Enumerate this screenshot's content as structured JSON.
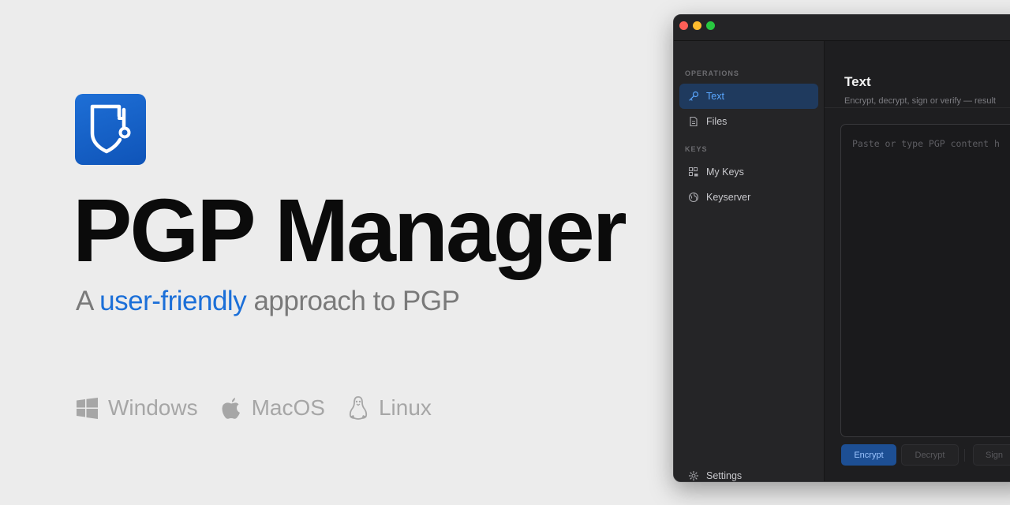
{
  "hero": {
    "title": "PGP Manager",
    "subtitle_prefix": "A ",
    "subtitle_accent": "user-friendly",
    "subtitle_suffix": " approach to PGP",
    "accent_color": "#1b6fd8",
    "icon": "shield-key-icon"
  },
  "platforms": [
    {
      "label": "Windows",
      "icon": "windows-icon"
    },
    {
      "label": "MacOS",
      "icon": "apple-icon"
    },
    {
      "label": "Linux",
      "icon": "linux-icon"
    }
  ],
  "window": {
    "sidebar": {
      "operations_label": "OPERATIONS",
      "keys_label": "KEYS",
      "items": [
        {
          "label": "Text",
          "icon": "key-icon",
          "active": true
        },
        {
          "label": "Files",
          "icon": "file-icon",
          "active": false
        },
        {
          "label": "My Keys",
          "icon": "keys-grid-icon",
          "active": false
        },
        {
          "label": "Keyserver",
          "icon": "globe-icon",
          "active": false
        }
      ],
      "settings_label": "Settings"
    },
    "main": {
      "title": "Text",
      "description": "Encrypt, decrypt, sign or verify — result",
      "editor_placeholder": "Paste or type PGP content h",
      "buttons": {
        "encrypt": "Encrypt",
        "decrypt": "Decrypt",
        "sign": "Sign"
      }
    }
  }
}
